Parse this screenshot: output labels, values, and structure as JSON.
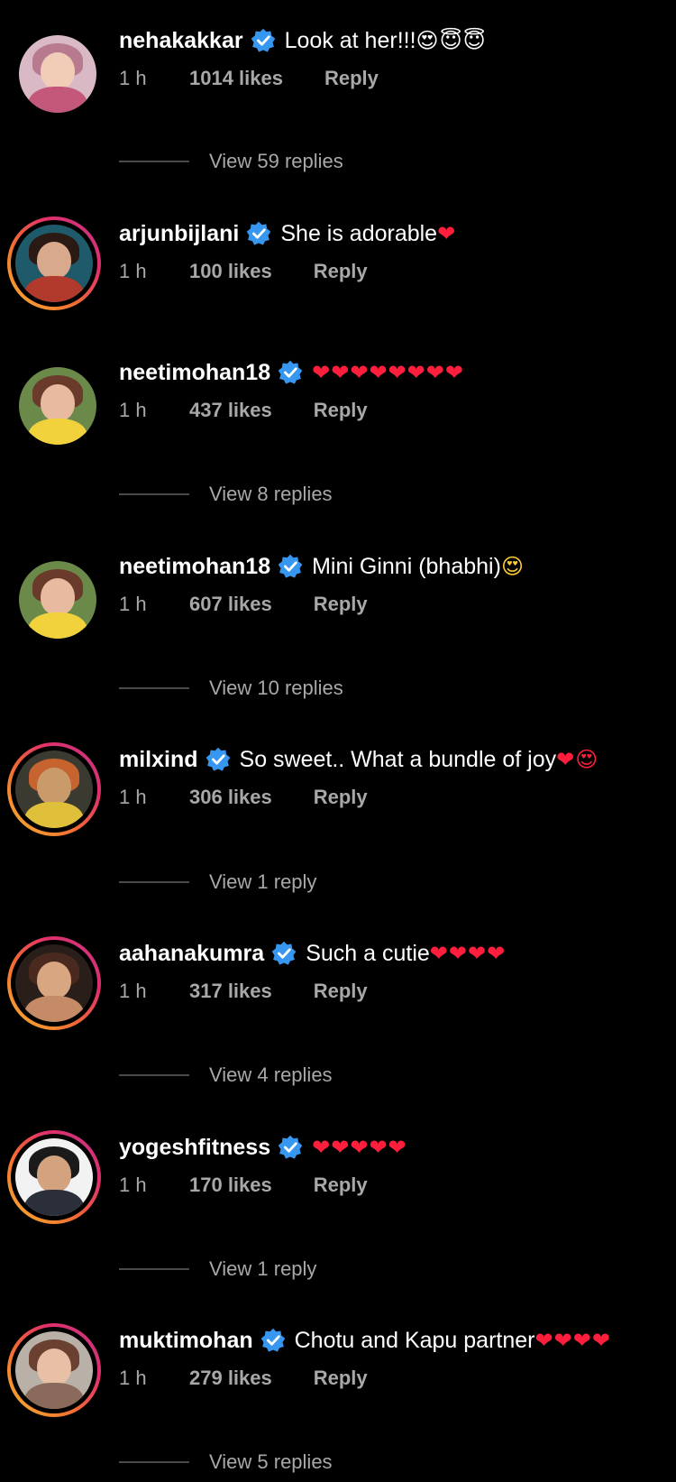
{
  "comments": [
    {
      "username": "nehakakkar",
      "text": "Look at her!!! ",
      "emoji": "😍😇😇",
      "time": "1 h",
      "likes": "1014 likes",
      "reply_label": "Reply",
      "view_replies": "View 59 replies",
      "has_story_ring": false
    },
    {
      "username": "arjunbijlani",
      "text": "She is adorable ",
      "emoji": "❤",
      "time": "1 h",
      "likes": "100 likes",
      "reply_label": "Reply",
      "view_replies": "",
      "has_story_ring": true
    },
    {
      "username": "neetimohan18",
      "text": "",
      "emoji": "❤❤❤❤❤❤❤❤",
      "time": "1 h",
      "likes": "437 likes",
      "reply_label": "Reply",
      "view_replies": "View 8 replies",
      "has_story_ring": false
    },
    {
      "username": "neetimohan18",
      "text": "Mini Ginni (bhabhi) ",
      "emoji": "😍",
      "time": "1 h",
      "likes": "607 likes",
      "reply_label": "Reply",
      "view_replies": "View 10 replies",
      "has_story_ring": false
    },
    {
      "username": "milxind",
      "text": "So sweet.. What a bundle of joy ",
      "emoji": "❤😍",
      "time": "1 h",
      "likes": "306 likes",
      "reply_label": "Reply",
      "view_replies": "View 1 reply",
      "has_story_ring": true
    },
    {
      "username": "aahanakumra",
      "text": "Such a cutie",
      "emoji": "❤❤❤❤",
      "time": "1 h",
      "likes": "317 likes",
      "reply_label": "Reply",
      "view_replies": "View 4 replies",
      "has_story_ring": true
    },
    {
      "username": "yogeshfitness",
      "text": "",
      "emoji": "❤❤❤❤❤",
      "time": "1 h",
      "likes": "170 likes",
      "reply_label": "Reply",
      "view_replies": "View 1 reply",
      "has_story_ring": true
    },
    {
      "username": "muktimohan",
      "text": "Chotu and Kapu partner",
      "emoji": "❤❤❤❤",
      "time": "1 h",
      "likes": "279 likes",
      "reply_label": "Reply",
      "view_replies": "View 5 replies",
      "has_story_ring": true
    }
  ],
  "colors": {
    "background": "#000000",
    "text_primary": "#ffffff",
    "text_secondary": "#a8a8a8",
    "verified_badge": "#3797f0",
    "heart": "#ff1f3d",
    "story_ring": "#e1306c"
  },
  "icons": {
    "verified": "verified-badge-icon"
  }
}
